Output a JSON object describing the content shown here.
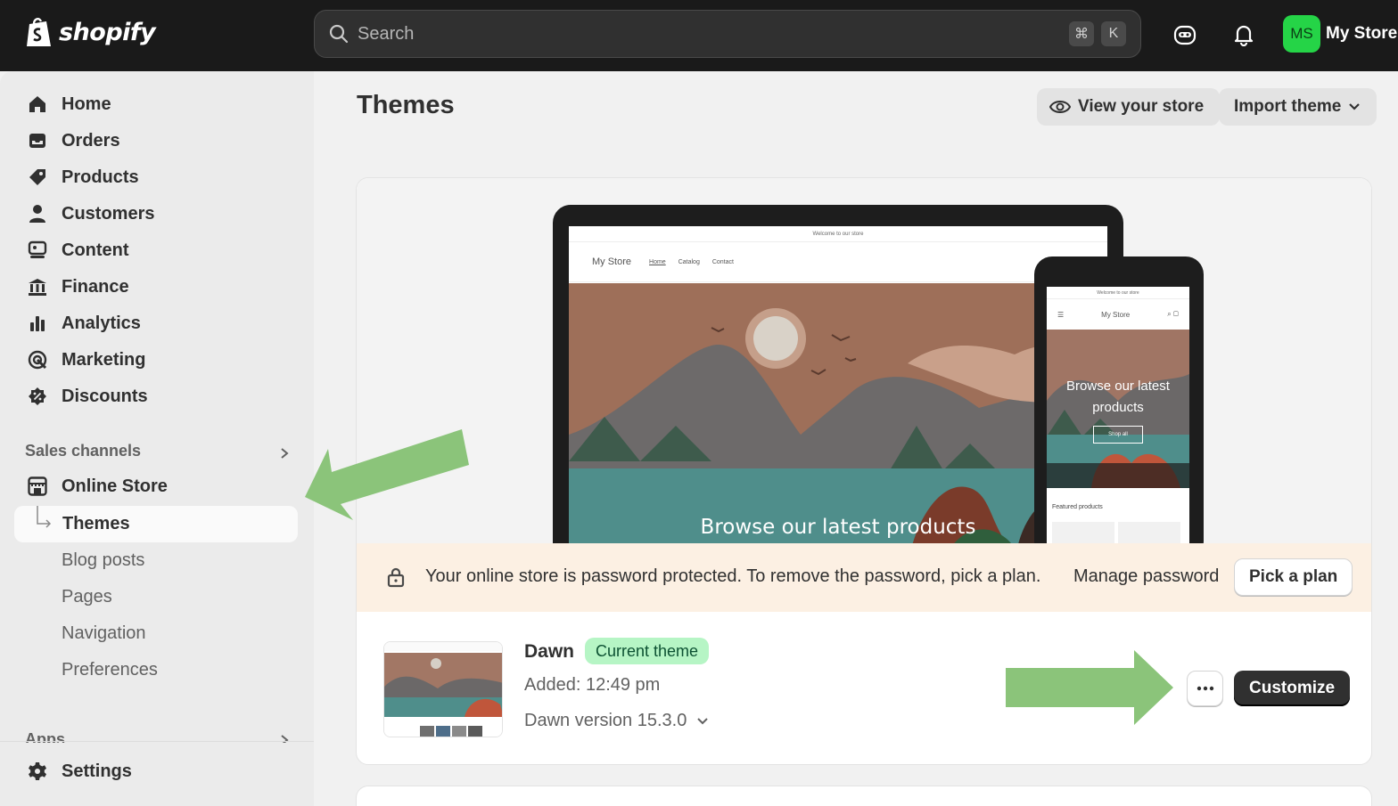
{
  "topbar": {
    "brand": "shopify",
    "search_placeholder": "Search",
    "shortcut_keys": [
      "⌘",
      "K"
    ],
    "store_initials": "MS",
    "store_name": "My Store",
    "avatar_color": "#25d447"
  },
  "sidebar": {
    "items": [
      {
        "label": "Home",
        "icon": "home-icon"
      },
      {
        "label": "Orders",
        "icon": "inbox-icon"
      },
      {
        "label": "Products",
        "icon": "tag-icon"
      },
      {
        "label": "Customers",
        "icon": "person-icon"
      },
      {
        "label": "Content",
        "icon": "content-icon"
      },
      {
        "label": "Finance",
        "icon": "bank-icon"
      },
      {
        "label": "Analytics",
        "icon": "bar-chart-icon"
      },
      {
        "label": "Marketing",
        "icon": "target-icon"
      },
      {
        "label": "Discounts",
        "icon": "discount-icon"
      }
    ],
    "sales_channels_label": "Sales channels",
    "online_store": {
      "label": "Online Store",
      "icon": "store-icon"
    },
    "online_store_sub": [
      {
        "label": "Themes",
        "active": true
      },
      {
        "label": "Blog posts"
      },
      {
        "label": "Pages"
      },
      {
        "label": "Navigation"
      },
      {
        "label": "Preferences"
      }
    ],
    "apps_label": "Apps",
    "settings": {
      "label": "Settings",
      "icon": "gear-icon"
    }
  },
  "main": {
    "title": "Themes",
    "view_store_label": "View your store",
    "import_theme_label": "Import theme",
    "preview": {
      "welcome": "Welcome to our store",
      "store_name": "My Store",
      "nav_links": [
        "Home",
        "Catalog",
        "Contact"
      ],
      "hero_text": "Browse our latest products",
      "mobile_hero_text": "Browse our latest products",
      "mobile_button": "Shop all",
      "featured": "Featured products"
    },
    "banner": {
      "text": "Your online store is password protected. To remove the password, pick a plan.",
      "manage_link": "Manage password",
      "button": "Pick a plan"
    },
    "current_theme": {
      "name": "Dawn",
      "badge": "Current theme",
      "added": "Added: 12:49 pm",
      "version": "Dawn version 15.3.0",
      "customize_label": "Customize"
    }
  },
  "annotations": {
    "arrow_color": "#8bc47a"
  }
}
